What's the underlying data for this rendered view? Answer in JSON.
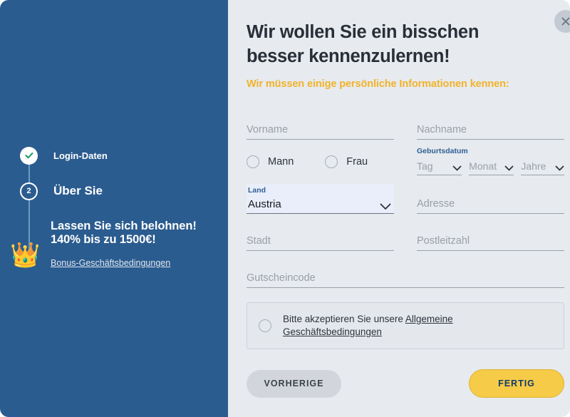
{
  "colors": {
    "sidebar_blue": "#2b5c8f",
    "panel_bg": "#e7eaee",
    "accent_yellow": "#f0b32a",
    "button_yellow": "#f5cb47",
    "label_blue": "#2f5f96",
    "check_green": "#2e9e6b"
  },
  "sidebar": {
    "steps": [
      {
        "label": "Login-Daten",
        "state": "completed",
        "marker": "check-icon"
      },
      {
        "label": "Über Sie",
        "state": "active",
        "marker": "2"
      }
    ],
    "bonus": {
      "line1": "Lassen Sie sich belohnen!",
      "line2": "140% bis zu 1500€!",
      "link": "Bonus-Geschäftsbedingungen",
      "icon": "crown-icon",
      "icon_glyph": "👑"
    }
  },
  "main": {
    "close_icon": "close-icon",
    "title_line1": "Wir wollen Sie ein bisschen",
    "title_line2": "besser kennenzulernen!",
    "subtitle": "Wir müssen einige persönliche Informationen kennen:",
    "fields": {
      "first_name": {
        "placeholder": "Vorname",
        "value": ""
      },
      "last_name": {
        "placeholder": "Nachname",
        "value": ""
      },
      "address": {
        "placeholder": "Adresse",
        "value": ""
      },
      "city": {
        "placeholder": "Stadt",
        "value": ""
      },
      "postcode": {
        "placeholder": "Postleitzahl",
        "value": ""
      },
      "voucher": {
        "placeholder": "Gutscheincode",
        "value": ""
      }
    },
    "gender": {
      "options": [
        {
          "label": "Mann",
          "selected": false
        },
        {
          "label": "Frau",
          "selected": false
        }
      ]
    },
    "birthdate": {
      "label": "Geburtsdatum",
      "day": "Tag",
      "month": "Monat",
      "year": "Jahre"
    },
    "country": {
      "label": "Land",
      "value": "Austria"
    },
    "terms": {
      "text_before": "Bitte akzeptieren Sie unsere ",
      "link_text": "Allgemeine Geschäftsbedingungen",
      "checked": false
    },
    "buttons": {
      "previous": "VORHERIGE",
      "done": "FERTIG"
    }
  }
}
